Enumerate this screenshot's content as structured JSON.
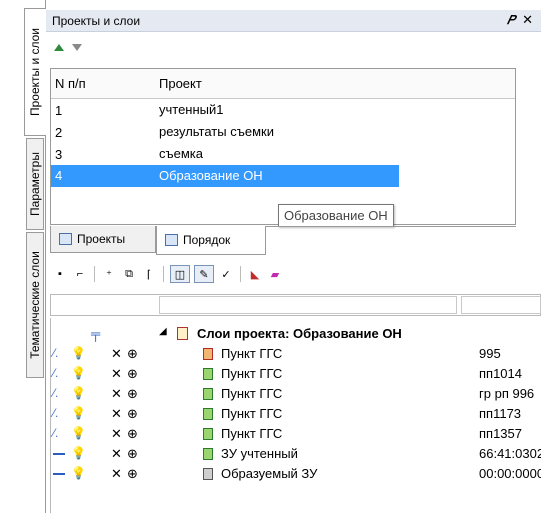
{
  "vertical_tabs": [
    {
      "label": "Проекты и слои",
      "active": true
    },
    {
      "label": "Параметры",
      "active": false
    },
    {
      "label": "Тематические слои",
      "active": false
    }
  ],
  "panel": {
    "title": "Проекты и слои",
    "pin_icon": "pin-icon",
    "close_icon": "close-icon"
  },
  "projects": {
    "headers": [
      "N п/п",
      "Проект"
    ],
    "rows": [
      {
        "num": "1",
        "name": "учтенный1"
      },
      {
        "num": "2",
        "name": "результаты съемки"
      },
      {
        "num": "3",
        "name": "съемка"
      },
      {
        "num": "4",
        "name": "Образование ОН",
        "selected": true
      }
    ],
    "tooltip": "Образование ОН"
  },
  "tabs": [
    {
      "label": "Проекты",
      "active": false
    },
    {
      "label": "Порядок",
      "active": true
    }
  ],
  "tree": {
    "root": "Слои проекта: Образование ОН",
    "layers": [
      {
        "name": "Пункт ГГС",
        "value": "995",
        "lit": false,
        "mark": "red"
      },
      {
        "name": "Пункт ГГС",
        "value": "пп1014",
        "lit": false,
        "mark": "green"
      },
      {
        "name": "Пункт ГГС",
        "value": "гр рп 996",
        "lit": false,
        "mark": "green"
      },
      {
        "name": "Пункт ГГС",
        "value": "пп1173",
        "lit": false,
        "mark": "green"
      },
      {
        "name": "Пункт ГГС",
        "value": "пп1357",
        "lit": false,
        "mark": "green"
      },
      {
        "name": "ЗУ учтенный",
        "value": "66:41:0302",
        "lit": true,
        "mark": "green"
      },
      {
        "name": "Образуемый ЗУ",
        "value": "00:00:0000",
        "lit": true,
        "mark": "gray"
      }
    ]
  },
  "colors": {
    "selection": "#3399ff",
    "title_bar": "#e4e9f2"
  }
}
